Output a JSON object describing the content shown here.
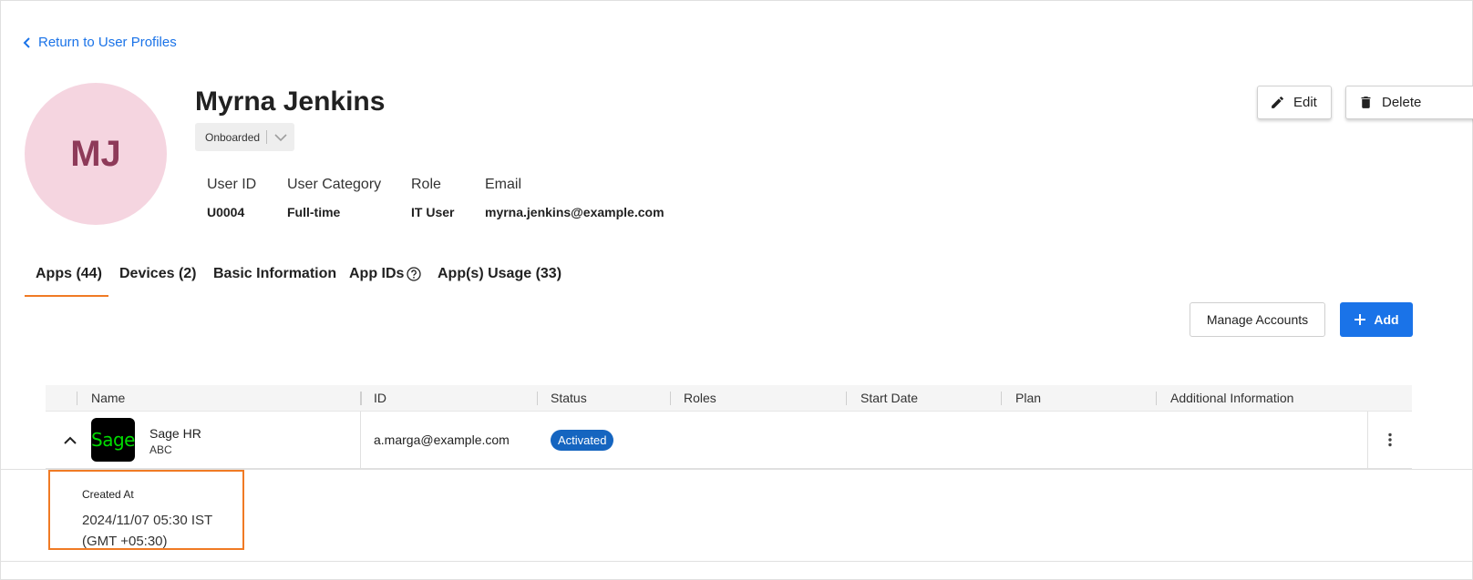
{
  "nav": {
    "back_label": "Return to User Profiles"
  },
  "profile": {
    "initials": "MJ",
    "name": "Myrna Jenkins",
    "status": "Onboarded",
    "fields": [
      {
        "label": "User ID",
        "value": "U0004"
      },
      {
        "label": "User Category",
        "value": "Full-time"
      },
      {
        "label": "Role",
        "value": "IT User"
      },
      {
        "label": "Email",
        "value": "myrna.jenkins@example.com"
      }
    ]
  },
  "actions": {
    "edit_label": "Edit",
    "delete_label": "Delete"
  },
  "tabs": [
    {
      "label": "Apps (44)",
      "active": true
    },
    {
      "label": "Devices (2)",
      "active": false
    },
    {
      "label": "Basic Information",
      "active": false
    },
    {
      "label": "App IDs",
      "active": false
    },
    {
      "label": "App(s) Usage (33)",
      "active": false
    }
  ],
  "toolbar": {
    "manage_label": "Manage Accounts",
    "add_label": "Add"
  },
  "table": {
    "columns": [
      "Name",
      "ID",
      "Status",
      "Roles",
      "Start Date",
      "Plan",
      "Additional Information"
    ],
    "rows": [
      {
        "logo_text": "Sage",
        "name": "Sage HR",
        "sub": "ABC",
        "id": "a.marga@example.com",
        "status": "Activated",
        "roles": "",
        "start_date": "",
        "plan": "",
        "additional": ""
      }
    ],
    "detail": {
      "label": "Created At",
      "value": "2024/11/07 05:30 IST (GMT +05:30)"
    }
  },
  "colors": {
    "accent": "#1a73e8",
    "tab_indicator": "#f07a24",
    "badge": "#1565c0",
    "avatar_bg": "#f5d5e0",
    "avatar_text": "#8e3a59"
  }
}
